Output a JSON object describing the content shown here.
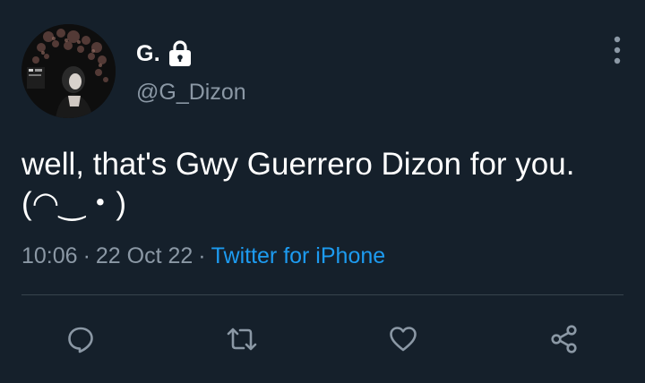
{
  "author": {
    "display_name": "G.",
    "handle": "@G_Dizon",
    "avatar_icon": "profile-photo",
    "protected_icon": "lock-icon"
  },
  "tweet": {
    "text": "well, that's Gwy Guerrero Dizon for you.(◠‿・)",
    "time": "10:06",
    "date": "22 Oct 22",
    "source": "Twitter for iPhone"
  },
  "menu": {
    "icon": "more-vertical-icon"
  },
  "actions": [
    {
      "name": "reply",
      "icon": "comment-icon"
    },
    {
      "name": "retweet",
      "icon": "retweet-icon"
    },
    {
      "name": "like",
      "icon": "heart-icon"
    },
    {
      "name": "share",
      "icon": "share-icon"
    }
  ],
  "colors": {
    "background": "#15202b",
    "primary_text": "#ffffff",
    "secondary_text": "#8b98a5",
    "link": "#1d9bf0",
    "divider": "#38444d"
  }
}
